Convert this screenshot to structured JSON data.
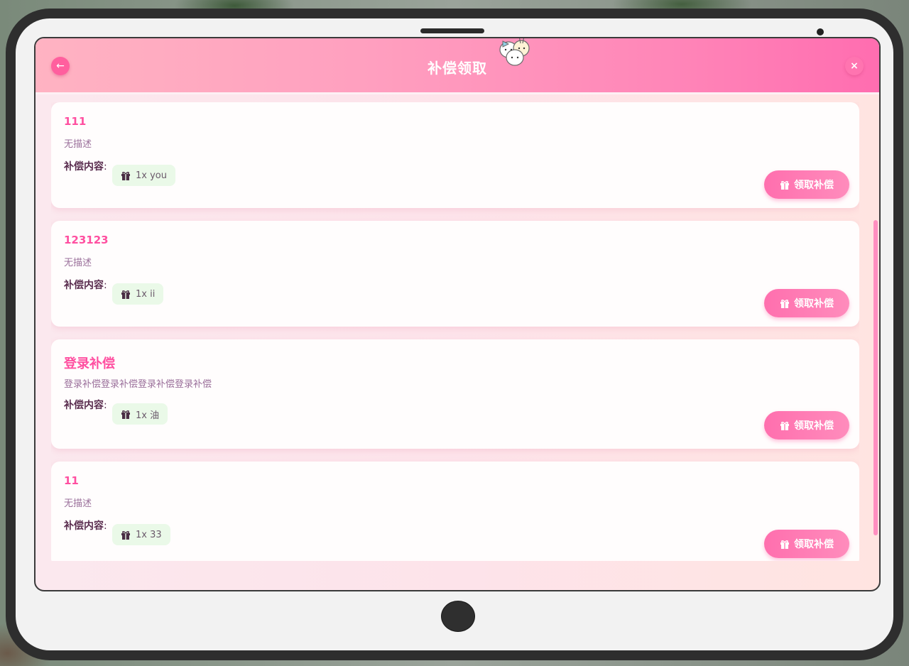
{
  "header": {
    "title": "补偿领取",
    "back_label": "←",
    "close_label": "×"
  },
  "compensations": [
    {
      "title": "111",
      "description": "无描述",
      "content_label": "补偿内容",
      "item": "1x you",
      "claim_label": "领取补偿"
    },
    {
      "title": "123123",
      "description": "无描述",
      "content_label": "补偿内容",
      "item": "1x ii",
      "claim_label": "领取补偿"
    },
    {
      "title": "登录补偿",
      "description": "登录补偿登录补偿登录补偿登录补偿",
      "content_label": "补偿内容",
      "item": "1x 油",
      "claim_label": "领取补偿"
    },
    {
      "title": "11",
      "description": "无描述",
      "content_label": "补偿内容",
      "item": "1x 33",
      "claim_label": "领取补偿"
    }
  ],
  "colors": {
    "accent": "#ff4fa0",
    "header_start": "#ffb3c2",
    "header_end": "#ff6db0",
    "item_tag_bg": "#eaf9e8"
  },
  "icons": {
    "back": "arrow-left-icon",
    "close": "close-icon",
    "gift": "gift-icon"
  }
}
